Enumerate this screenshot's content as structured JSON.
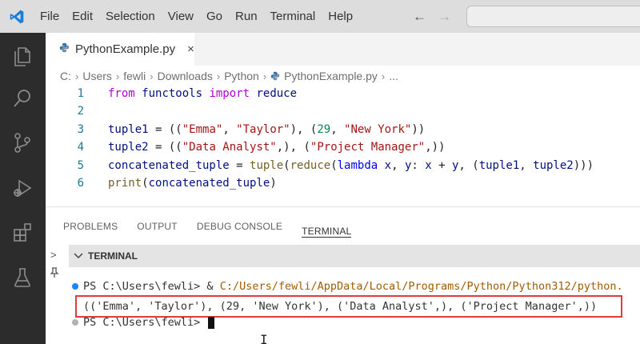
{
  "menu": [
    "File",
    "Edit",
    "Selection",
    "View",
    "Go",
    "Run",
    "Terminal",
    "Help"
  ],
  "nav": {
    "back_icon": "arrow-left-icon",
    "forward_icon": "arrow-right-icon"
  },
  "activity_bar": [
    "explorer-icon",
    "search-icon",
    "source-control-icon",
    "run-debug-icon",
    "extensions-icon",
    "testing-icon"
  ],
  "editor": {
    "tab_label": "PythonExample.py",
    "tab_close": "×",
    "breadcrumb": [
      "C:",
      "Users",
      "fewli",
      "Downloads",
      "Python",
      "PythonExample.py",
      "..."
    ],
    "lines": [
      {
        "n": "1",
        "tokens": [
          [
            "kw",
            "from"
          ],
          [
            "plain",
            " "
          ],
          [
            "var",
            "functools"
          ],
          [
            "plain",
            " "
          ],
          [
            "kw",
            "import"
          ],
          [
            "plain",
            " "
          ],
          [
            "var",
            "reduce"
          ]
        ]
      },
      {
        "n": "2",
        "tokens": []
      },
      {
        "n": "3",
        "tokens": [
          [
            "var",
            "tuple1"
          ],
          [
            "plain",
            " = (("
          ],
          [
            "str",
            "\"Emma\""
          ],
          [
            "plain",
            ", "
          ],
          [
            "str",
            "\"Taylor\""
          ],
          [
            "plain",
            "), ("
          ],
          [
            "num",
            "29"
          ],
          [
            "plain",
            ", "
          ],
          [
            "str",
            "\"New York\""
          ],
          [
            "plain",
            "))"
          ]
        ]
      },
      {
        "n": "4",
        "tokens": [
          [
            "var",
            "tuple2"
          ],
          [
            "plain",
            " = (("
          ],
          [
            "str",
            "\"Data Analyst\""
          ],
          [
            "plain",
            ",), ("
          ],
          [
            "str",
            "\"Project Manager\""
          ],
          [
            "plain",
            ",))"
          ]
        ]
      },
      {
        "n": "5",
        "tokens": [
          [
            "var",
            "concatenated_tuple"
          ],
          [
            "plain",
            " = "
          ],
          [
            "fn",
            "tuple"
          ],
          [
            "plain",
            "("
          ],
          [
            "fn",
            "reduce"
          ],
          [
            "plain",
            "("
          ],
          [
            "blue",
            "lambda"
          ],
          [
            "plain",
            " "
          ],
          [
            "var",
            "x"
          ],
          [
            "plain",
            ", "
          ],
          [
            "var",
            "y"
          ],
          [
            "plain",
            ": "
          ],
          [
            "var",
            "x"
          ],
          [
            "plain",
            " + "
          ],
          [
            "var",
            "y"
          ],
          [
            "plain",
            ", ("
          ],
          [
            "var",
            "tuple1"
          ],
          [
            "plain",
            ", "
          ],
          [
            "var",
            "tuple2"
          ],
          [
            "plain",
            ")))"
          ]
        ]
      },
      {
        "n": "6",
        "tokens": [
          [
            "fn",
            "print"
          ],
          [
            "plain",
            "("
          ],
          [
            "var",
            "concatenated_tuple"
          ],
          [
            "plain",
            ")"
          ]
        ]
      }
    ]
  },
  "panel": {
    "tabs": [
      "PROBLEMS",
      "OUTPUT",
      "DEBUG CONSOLE",
      "TERMINAL"
    ],
    "active_tab": "TERMINAL",
    "terminal_header": "TERMINAL",
    "lines": {
      "cmd_prefix": "PS C:\\Users\\fewli> & ",
      "cmd_path": "C:/Users/fewli/AppData/Local/Programs/Python/Python312/python.",
      "output": "(('Emma', 'Taylor'), (29, 'New York'), ('Data Analyst',), ('Project Manager',))",
      "prompt": "PS C:\\Users\\fewli> "
    }
  }
}
